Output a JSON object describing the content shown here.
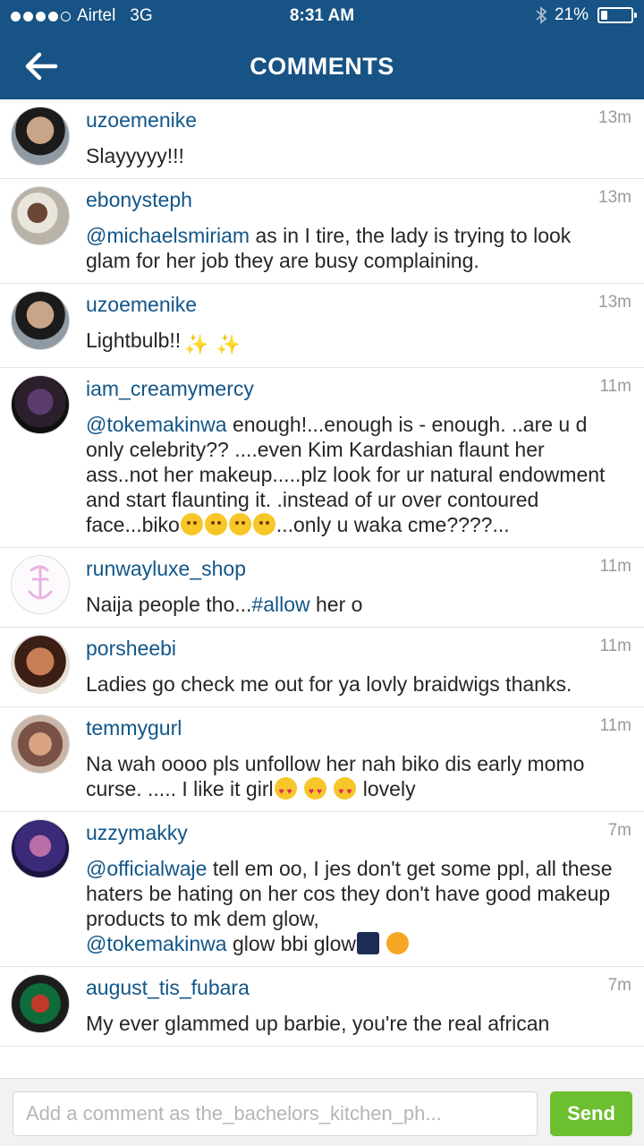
{
  "status_bar": {
    "carrier": "Airtel",
    "network": "3G",
    "time": "8:31 AM",
    "battery": "21%",
    "battery_level": 0.21
  },
  "header": {
    "title": "COMMENTS"
  },
  "comments": [
    {
      "username": "uzoemenike",
      "time": "13m",
      "text": "Slayyyyy!!!"
    },
    {
      "username": "ebonysteph",
      "time": "13m",
      "mention": "@michaelsmiriam",
      "text": " as in I tire, the lady is trying to look glam for her job they are busy complaining."
    },
    {
      "username": "uzoemenike",
      "time": "13m",
      "text": "Lightbulb!!"
    },
    {
      "username": "iam_creamymercy",
      "time": "11m",
      "mention": "@tokemakinwa",
      "text": " enough!...enough is - enough. ..are u d only celebrity?? ....even Kim Kardashian flaunt her ass..not her makeup.....plz look for ur natural endowment and start flaunting it. .instead of ur over contoured face...biko",
      "text_after": "...only u waka cme????..."
    },
    {
      "username": "runwayluxe_shop",
      "time": "11m",
      "text": "Naija people tho...",
      "hashtag": "#allow",
      "text_after": " her o"
    },
    {
      "username": "porsheebi",
      "time": "11m",
      "text": "Ladies go check me out for ya lovly braidwigs thanks."
    },
    {
      "username": "temmygurl",
      "time": "11m",
      "text": "Na wah oooo pls unfollow her nah biko dis early momo curse. ..... I like it girl",
      "text_after": " lovely"
    },
    {
      "username": "uzzymakky",
      "time": "7m",
      "mention": "@officialwaje",
      "text": "  tell em oo, I jes don't get some ppl, all these haters be hating on her cos they don't have good makeup products to mk dem glow,",
      "mention2": "@tokemakinwa",
      "text_after": "  glow bbi glow"
    },
    {
      "username": "august_tis_fubara",
      "time": "7m",
      "text": "My ever glammed up barbie, you're the real african"
    }
  ],
  "composer": {
    "placeholder": "Add a comment as the_bachelors_kitchen_ph...",
    "send_label": "Send"
  },
  "colors": {
    "header": "#175384",
    "username": "#125688",
    "send": "#6cbf2e"
  }
}
